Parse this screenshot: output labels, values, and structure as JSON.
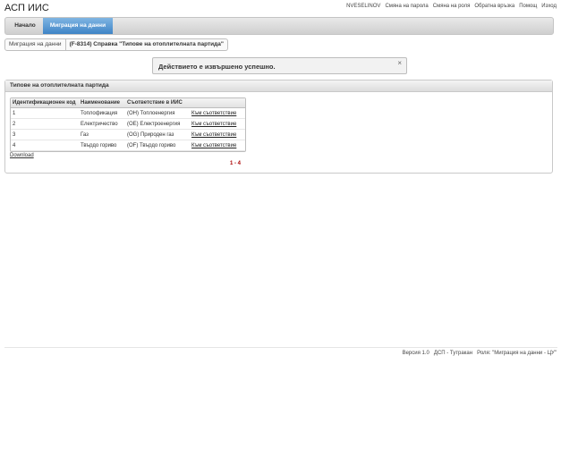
{
  "app": {
    "title": "АСП ИИС"
  },
  "top_links": {
    "user": "NVESELINOV",
    "change_password": "Смяна на парола",
    "change_role": "Смяна на роля",
    "feedback": "Обратна връзка",
    "help": "Помощ",
    "logout": "Изход"
  },
  "nav": {
    "home": "Начало",
    "migration": "Миграция на данни"
  },
  "breadcrumb": {
    "item1": "Миграция на данни",
    "item2": "(F-8314) Справка \"Типове на отоплителната партида\""
  },
  "message": {
    "text": "Действието е извършено успешно.",
    "close": "×"
  },
  "panel": {
    "title": "Типове на отоплителната партида"
  },
  "table": {
    "headers": [
      "Идентификационен код",
      "Наименование",
      "Съответствие в ИИС",
      ""
    ],
    "rows": [
      [
        "1",
        "Топлофикация",
        "(OH) Топлоенергия",
        "Към съответствие"
      ],
      [
        "2",
        "Електричество",
        "(OE) Електроенергия",
        "Към съответствие"
      ],
      [
        "3",
        "Газ",
        "(OG) Природен газ",
        "Към съответствие"
      ],
      [
        "4",
        "Твърдо гориво",
        "(OF) Твърдо гориво",
        "Към съответствие"
      ]
    ]
  },
  "download": "Download",
  "pager": "1 - 4",
  "footer": {
    "version": "Версия 1.0",
    "office": "ДСП - Тутракан",
    "role": "Роля: \"Миграция на данни - ЦУ\""
  },
  "colors": {
    "accent": "#3f84c6",
    "pager": "#aa0000"
  }
}
